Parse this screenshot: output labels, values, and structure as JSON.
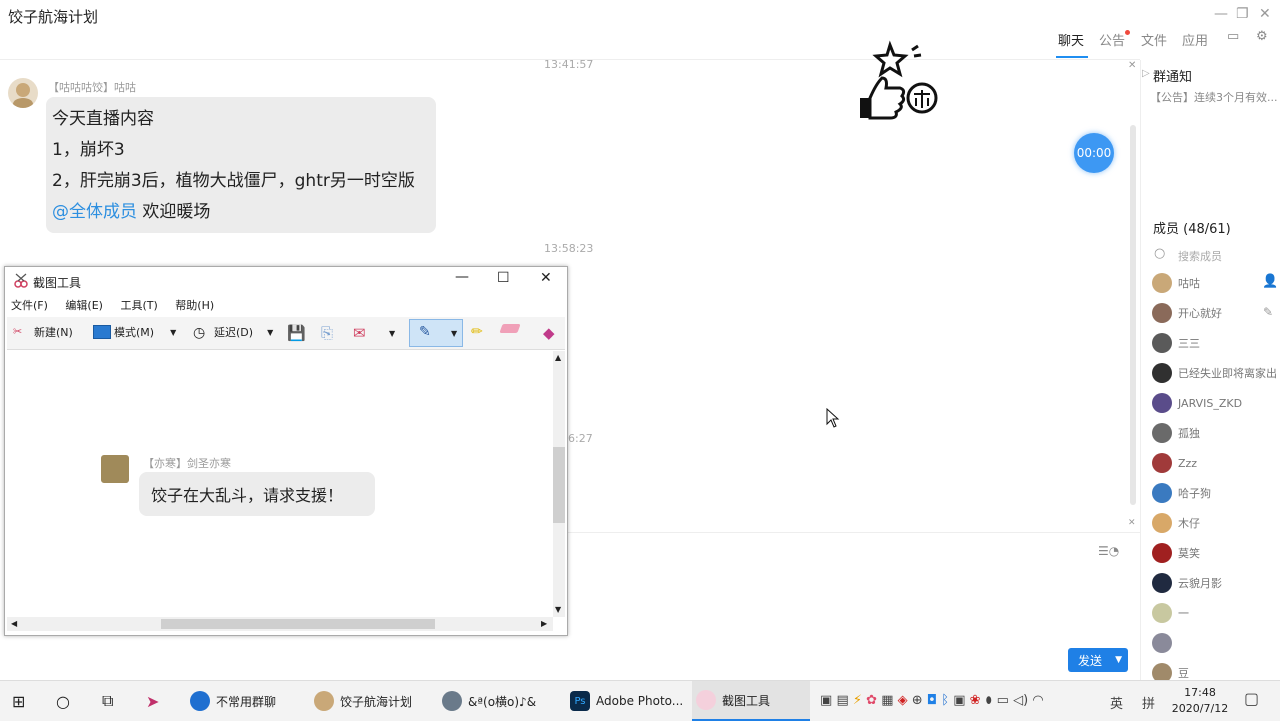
{
  "window": {
    "title": "饺子航海计划"
  },
  "tabs": [
    {
      "label": "聊天",
      "active": true
    },
    {
      "label": "公告",
      "active": false,
      "dot": true
    },
    {
      "label": "文件",
      "active": false
    },
    {
      "label": "应用",
      "active": false
    }
  ],
  "chat": {
    "timestamps": [
      "13:41:57",
      "13:58:23",
      "6:27"
    ],
    "message1": {
      "sender": "【咕咕咕饺】咕咕",
      "lines": [
        "今天直播内容",
        "1，崩坏3",
        "2，肝完崩3后，植物大战僵尸，ghtr另一时空版"
      ],
      "mention": "@全体成员",
      "mention_tail": " 欢迎暖场"
    },
    "timer": "00:00",
    "send_label": "发送"
  },
  "right_panel": {
    "notice_title": "群通知",
    "notice_text": "【公告】连续3个月有效...",
    "members_title": "成员 (48/61)",
    "search_placeholder": "搜索成员",
    "members": [
      {
        "name": "咕咕",
        "color": "#c9a878"
      },
      {
        "name": "开心就好",
        "color": "#8a6a5a"
      },
      {
        "name": "三三",
        "color": "#5a5a5a"
      },
      {
        "name": "已经失业即将离家出",
        "color": "#303030"
      },
      {
        "name": "JARVIS_ZKD",
        "color": "#5a4c8a"
      },
      {
        "name": "孤独",
        "color": "#6a6a6a"
      },
      {
        "name": "Zzz",
        "color": "#a03a3a"
      },
      {
        "name": "哈子狗",
        "color": "#3a7ac0"
      },
      {
        "name": "木仔",
        "color": "#d8a868"
      },
      {
        "name": "莫笑",
        "color": "#a02020"
      },
      {
        "name": "云貌月影",
        "color": "#202a40"
      },
      {
        "name": "一",
        "color": "#c8c8a0"
      },
      {
        "name": "",
        "color": "#8a8a9a"
      },
      {
        "name": "豆",
        "color": "#a08a6a"
      }
    ]
  },
  "snip": {
    "title": "截图工具",
    "menu": [
      "文件(F)",
      "编辑(E)",
      "工具(T)",
      "帮助(H)"
    ],
    "toolbar": {
      "new": "新建(N)",
      "mode": "模式(M)",
      "delay": "延迟(D)"
    },
    "inner_message": {
      "sender": "【亦寒】剑圣亦寒",
      "text": "饺子在大乱斗，请求支援！"
    }
  },
  "taskbar": {
    "items": [
      {
        "label": "不常用群聊",
        "color": "#1f6fd0"
      },
      {
        "label": "饺子航海计划",
        "color": "#c9a878"
      },
      {
        "label": "&ª(о横о)♪&",
        "color": "#6a7a8a"
      },
      {
        "label": "Adobe Photo...",
        "color": "#0a2a4a"
      },
      {
        "label": "截图工具",
        "color": "#d06a8a"
      }
    ],
    "lang": "英",
    "ime": "拼",
    "time": "17:48",
    "date": "2020/7/12"
  }
}
